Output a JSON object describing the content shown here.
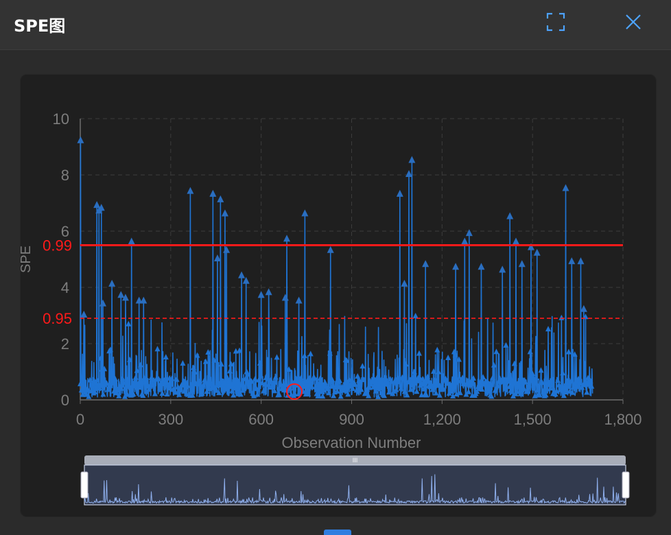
{
  "window": {
    "title": "SPE图",
    "fullscreen_icon": "fullscreen-icon",
    "close_icon": "close-icon"
  },
  "colors": {
    "background": "#2b2b2b",
    "panel": "#1f1f1f",
    "series": "#1f74d4",
    "threshold": "#ff1a1a",
    "axis_text": "#7d7d7d",
    "grid": "#3c3c3c",
    "accent": "#4da3ff"
  },
  "chart_data": {
    "type": "line",
    "title": "",
    "xlabel": "Observation Number",
    "ylabel": "SPE",
    "xlim": [
      0,
      1800
    ],
    "ylim": [
      0,
      10
    ],
    "xticks": [
      "0",
      "300",
      "600",
      "900",
      "1,200",
      "1,500",
      "1,800"
    ],
    "yticks": [
      "0",
      "2",
      "4",
      "6",
      "8",
      "10"
    ],
    "grid": true,
    "legend": "none",
    "n_observations": 1700,
    "series": [
      {
        "marker": "triangle",
        "peaks": [
          [
            1,
            9.2
          ],
          [
            12,
            3.0
          ],
          [
            55,
            6.9
          ],
          [
            62,
            6.7
          ],
          [
            70,
            6.8
          ],
          [
            75,
            3.4
          ],
          [
            105,
            4.1
          ],
          [
            135,
            3.7
          ],
          [
            150,
            3.6
          ],
          [
            170,
            5.6
          ],
          [
            195,
            3.5
          ],
          [
            210,
            3.5
          ],
          [
            365,
            7.4
          ],
          [
            440,
            7.3
          ],
          [
            455,
            5.0
          ],
          [
            465,
            7.1
          ],
          [
            480,
            6.6
          ],
          [
            485,
            5.3
          ],
          [
            535,
            4.4
          ],
          [
            550,
            4.2
          ],
          [
            600,
            3.7
          ],
          [
            625,
            3.8
          ],
          [
            680,
            3.6
          ],
          [
            685,
            5.7
          ],
          [
            725,
            3.5
          ],
          [
            745,
            6.6
          ],
          [
            830,
            5.3
          ],
          [
            1060,
            7.3
          ],
          [
            1075,
            4.1
          ],
          [
            1090,
            8.0
          ],
          [
            1100,
            8.5
          ],
          [
            1145,
            4.8
          ],
          [
            1245,
            4.7
          ],
          [
            1275,
            5.6
          ],
          [
            1290,
            5.9
          ],
          [
            1330,
            4.7
          ],
          [
            1400,
            4.6
          ],
          [
            1425,
            6.5
          ],
          [
            1445,
            5.6
          ],
          [
            1465,
            4.8
          ],
          [
            1495,
            5.4
          ],
          [
            1515,
            5.2
          ],
          [
            1610,
            7.5
          ],
          [
            1630,
            4.9
          ],
          [
            1660,
            4.9
          ],
          [
            1670,
            3.2
          ]
        ]
      }
    ],
    "thresholds": [
      {
        "label": "0.99",
        "value": 5.5,
        "style": "solid"
      },
      {
        "label": "0.95",
        "value": 2.9,
        "style": "dashed"
      }
    ],
    "annotations": [
      {
        "type": "circle-marker",
        "x": 710,
        "y": 0.1
      }
    ],
    "data_zoom": {
      "start": 0,
      "end": 100,
      "handle_label": "III"
    }
  }
}
